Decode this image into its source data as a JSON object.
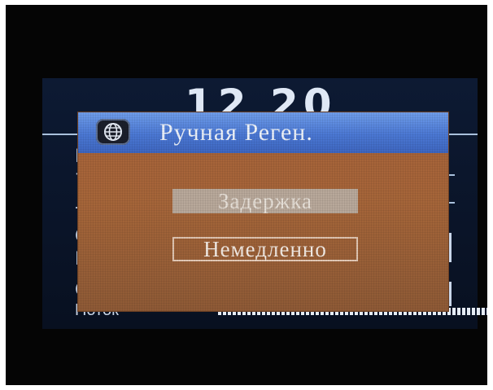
{
  "screen": {
    "clock": "12 20",
    "left_fragments": [
      "I",
      "7",
      "-",
      "C",
      "E",
      "C"
    ],
    "bottom_label": "Поток"
  },
  "dialog": {
    "title": "Ручная Реген.",
    "icon": "globe-icon",
    "options": [
      {
        "label": "Задержка",
        "selected": true
      },
      {
        "label": "Немедленно",
        "selected": false
      }
    ]
  },
  "colors": {
    "dialog_header": "#4b78d4",
    "dialog_body": "#a5633a",
    "screen_bg": "#0b1630",
    "highlight": "#b8a89a"
  }
}
